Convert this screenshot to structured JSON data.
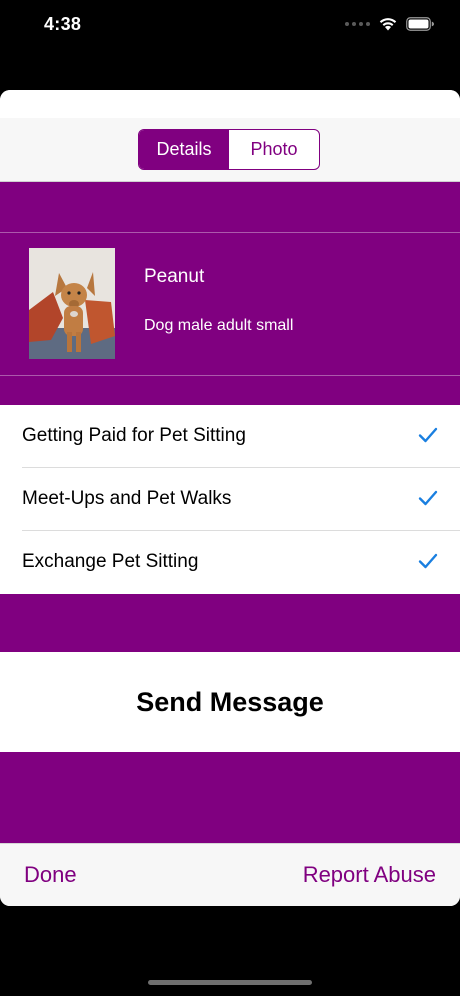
{
  "status_bar": {
    "time": "4:38",
    "wifi_icon": "wifi-icon",
    "battery_icon": "battery-icon"
  },
  "segmented_control": {
    "items": [
      {
        "label": "Details",
        "selected": true
      },
      {
        "label": "Photo",
        "selected": false
      }
    ]
  },
  "pet": {
    "name": "Peanut",
    "description": "Dog male adult small",
    "photo_icon": "dog-photo"
  },
  "options": [
    {
      "label": "Getting Paid for Pet Sitting",
      "checked": true
    },
    {
      "label": "Meet-Ups and Pet Walks",
      "checked": true
    },
    {
      "label": "Exchange Pet Sitting",
      "checked": true
    }
  ],
  "send_message_label": "Send Message",
  "toolbar": {
    "done_label": "Done",
    "report_label": "Report Abuse"
  },
  "colors": {
    "accent": "#800080",
    "check": "#1a7fe0"
  }
}
